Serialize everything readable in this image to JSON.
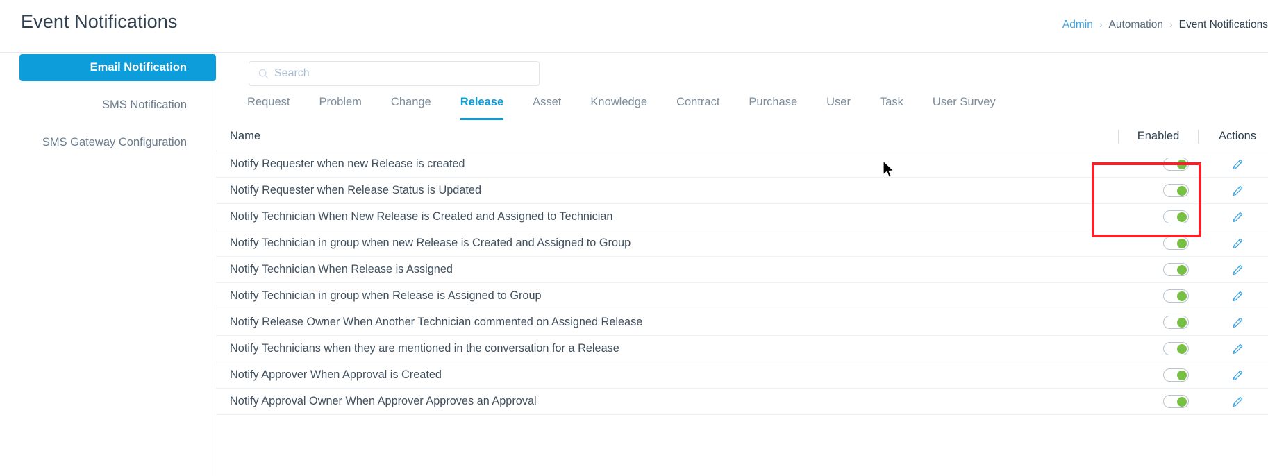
{
  "header": {
    "title": "Event Notifications",
    "breadcrumb": [
      {
        "label": "Admin",
        "type": "link"
      },
      {
        "label": "Automation",
        "type": "text"
      },
      {
        "label": "Event Notifications",
        "type": "current"
      }
    ],
    "separator": "›"
  },
  "sidebar": {
    "items": [
      {
        "label": "Email Notification",
        "active": true
      },
      {
        "label": "SMS Notification",
        "active": false
      },
      {
        "label": "SMS Gateway Configuration",
        "active": false
      }
    ]
  },
  "search": {
    "placeholder": "Search",
    "value": "",
    "icon": "search-icon"
  },
  "tabs": [
    {
      "label": "Request",
      "active": false
    },
    {
      "label": "Problem",
      "active": false
    },
    {
      "label": "Change",
      "active": false
    },
    {
      "label": "Release",
      "active": true
    },
    {
      "label": "Asset",
      "active": false
    },
    {
      "label": "Knowledge",
      "active": false
    },
    {
      "label": "Contract",
      "active": false
    },
    {
      "label": "Purchase",
      "active": false
    },
    {
      "label": "User",
      "active": false
    },
    {
      "label": "Task",
      "active": false
    },
    {
      "label": "User Survey",
      "active": false
    }
  ],
  "table": {
    "columns": {
      "name": "Name",
      "enabled": "Enabled",
      "actions": "Actions"
    },
    "rows": [
      {
        "name": "Notify Requester when new Release is created",
        "enabled": true,
        "action_icon": "pencil-icon"
      },
      {
        "name": "Notify Requester when Release Status is Updated",
        "enabled": true,
        "action_icon": "pencil-icon"
      },
      {
        "name": "Notify Technician When New Release is Created and Assigned to Technician",
        "enabled": true,
        "action_icon": "pencil-icon"
      },
      {
        "name": "Notify Technician in group when new Release is Created and Assigned to Group",
        "enabled": true,
        "action_icon": "pencil-icon"
      },
      {
        "name": "Notify Technician When Release is Assigned",
        "enabled": true,
        "action_icon": "pencil-icon"
      },
      {
        "name": "Notify Technician in group when Release is Assigned to Group",
        "enabled": true,
        "action_icon": "pencil-icon"
      },
      {
        "name": "Notify Release Owner When Another Technician commented on Assigned Release",
        "enabled": true,
        "action_icon": "pencil-icon"
      },
      {
        "name": "Notify Technicians when they are mentioned in the conversation for a Release",
        "enabled": true,
        "action_icon": "pencil-icon"
      },
      {
        "name": "Notify Approver When Approval is Created",
        "enabled": true,
        "action_icon": "pencil-icon"
      },
      {
        "name": "Notify Approval Owner When Approver Approves an Approval",
        "enabled": true,
        "action_icon": "pencil-icon"
      }
    ]
  },
  "colors": {
    "accent": "#0d9ddb",
    "link": "#3ea4e0",
    "toggle_on": "#78c043",
    "annotation": "#f3232b",
    "text": "#41505e"
  }
}
